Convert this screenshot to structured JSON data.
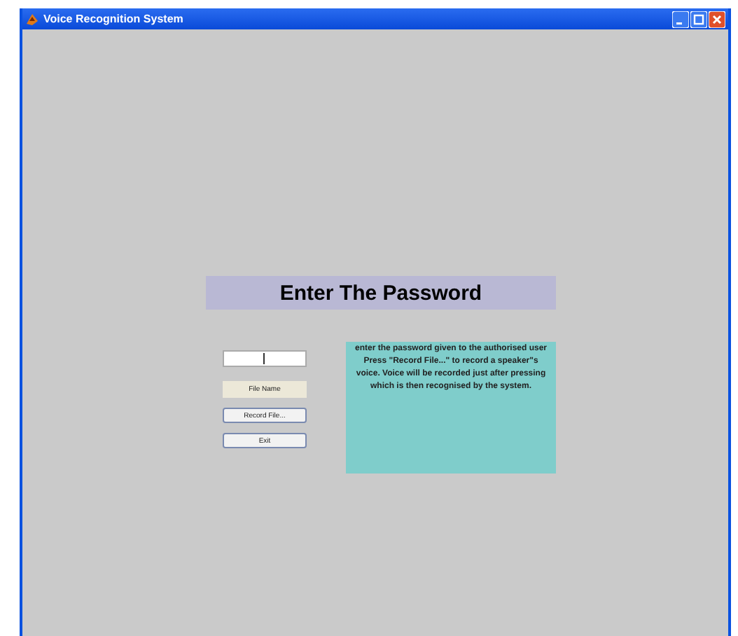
{
  "window": {
    "title": "Voice Recognition System"
  },
  "heading": "Enter The Password",
  "password_field": {
    "focused": true
  },
  "file_name_label": "File Name",
  "buttons": [
    "Record File...",
    "Exit"
  ],
  "instructions": "enter the password given to the authorised user Press  \"Record File...\" to record a speaker\"s voice.  Voice will be recorded just after pressing which is then recognised by the system."
}
